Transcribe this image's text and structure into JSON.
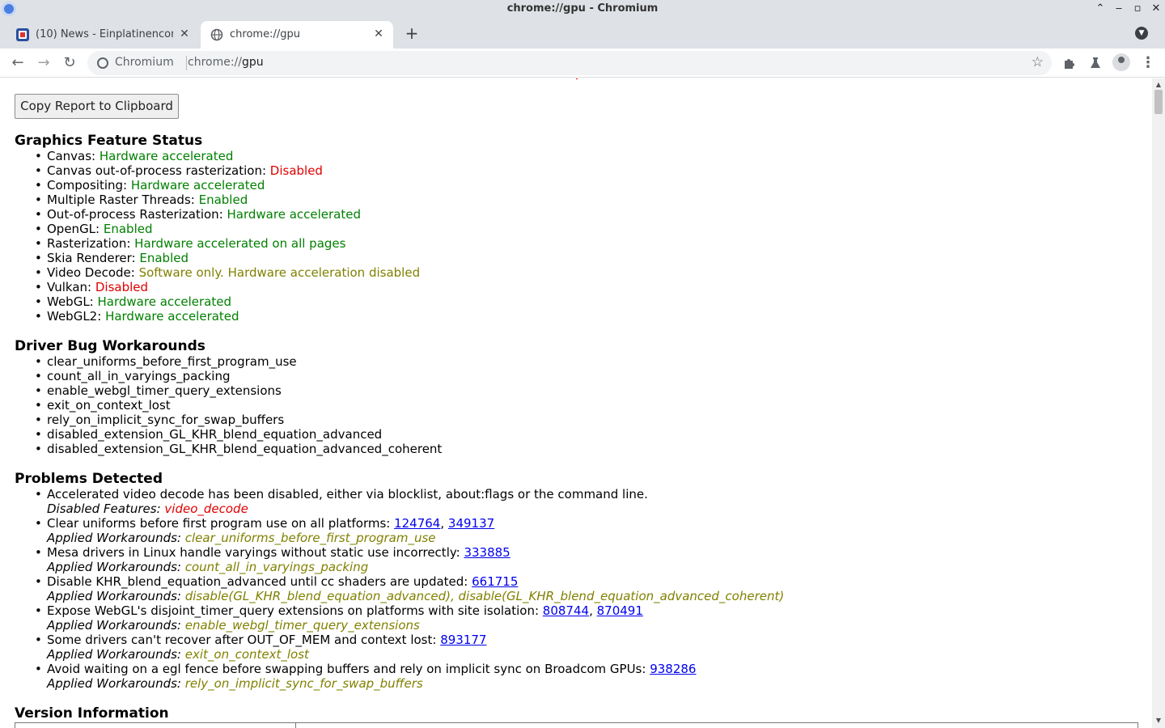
{
  "window": {
    "title": "chrome://gpu - Chromium"
  },
  "tabs": [
    {
      "title": "(10) News - Einplatinencom",
      "active": false
    },
    {
      "title": "chrome://gpu",
      "active": true
    }
  ],
  "toolbar": {
    "omnibox_chip": "Chromium",
    "url_scheme": "chrome://",
    "url_host": "gpu"
  },
  "content": {
    "copy_button": "Copy Report to Clipboard",
    "feature_status": {
      "heading": "Graphics Feature Status",
      "items": [
        {
          "name": "Canvas: ",
          "value": "Hardware accelerated",
          "status": "green"
        },
        {
          "name": "Canvas out-of-process rasterization: ",
          "value": "Disabled",
          "status": "red"
        },
        {
          "name": "Compositing: ",
          "value": "Hardware accelerated",
          "status": "green"
        },
        {
          "name": "Multiple Raster Threads: ",
          "value": "Enabled",
          "status": "green"
        },
        {
          "name": "Out-of-process Rasterization: ",
          "value": "Hardware accelerated",
          "status": "green"
        },
        {
          "name": "OpenGL: ",
          "value": "Enabled",
          "status": "green"
        },
        {
          "name": "Rasterization: ",
          "value": "Hardware accelerated on all pages",
          "status": "green"
        },
        {
          "name": "Skia Renderer: ",
          "value": "Enabled",
          "status": "green"
        },
        {
          "name": "Video Decode: ",
          "value": "Software only. Hardware acceleration disabled",
          "status": "olive"
        },
        {
          "name": "Vulkan: ",
          "value": "Disabled",
          "status": "red"
        },
        {
          "name": "WebGL: ",
          "value": "Hardware accelerated",
          "status": "green"
        },
        {
          "name": "WebGL2: ",
          "value": "Hardware accelerated",
          "status": "green"
        }
      ]
    },
    "workarounds": {
      "heading": "Driver Bug Workarounds",
      "items": [
        "clear_uniforms_before_first_program_use",
        "count_all_in_varyings_packing",
        "enable_webgl_timer_query_extensions",
        "exit_on_context_lost",
        "rely_on_implicit_sync_for_swap_buffers",
        "disabled_extension_GL_KHR_blend_equation_advanced",
        "disabled_extension_GL_KHR_blend_equation_advanced_coherent"
      ]
    },
    "problems": {
      "heading": "Problems Detected",
      "items": [
        {
          "text": "Accelerated video decode has been disabled, either via blocklist, about:flags or the command line.",
          "links": [],
          "sub_label": "Disabled Features: ",
          "sub_values": [
            "video_decode"
          ],
          "sub_status": "red"
        },
        {
          "text": "Clear uniforms before first program use on all platforms: ",
          "links": [
            "124764",
            "349137"
          ],
          "sub_label": "Applied Workarounds: ",
          "sub_values": [
            "clear_uniforms_before_first_program_use"
          ],
          "sub_status": "olive"
        },
        {
          "text": "Mesa drivers in Linux handle varyings without static use incorrectly: ",
          "links": [
            "333885"
          ],
          "sub_label": "Applied Workarounds: ",
          "sub_values": [
            "count_all_in_varyings_packing"
          ],
          "sub_status": "olive"
        },
        {
          "text": "Disable KHR_blend_equation_advanced until cc shaders are updated: ",
          "links": [
            "661715"
          ],
          "sub_label": "Applied Workarounds: ",
          "sub_values": [
            "disable(GL_KHR_blend_equation_advanced)",
            "disable(GL_KHR_blend_equation_advanced_coherent)"
          ],
          "sub_status": "olive"
        },
        {
          "text": "Expose WebGL's disjoint_timer_query extensions on platforms with site isolation: ",
          "links": [
            "808744",
            "870491"
          ],
          "sub_label": "Applied Workarounds: ",
          "sub_values": [
            "enable_webgl_timer_query_extensions"
          ],
          "sub_status": "olive"
        },
        {
          "text": "Some drivers can't recover after OUT_OF_MEM and context lost: ",
          "links": [
            "893177"
          ],
          "sub_label": "Applied Workarounds: ",
          "sub_values": [
            "exit_on_context_lost"
          ],
          "sub_status": "olive"
        },
        {
          "text": "Avoid waiting on a egl fence before swapping buffers and rely on implicit sync on Broadcom GPUs: ",
          "links": [
            "938286"
          ],
          "sub_label": "Applied Workarounds: ",
          "sub_values": [
            "rely_on_implicit_sync_for_swap_buffers"
          ],
          "sub_status": "olive"
        }
      ]
    },
    "version": {
      "heading": "Version Information"
    }
  },
  "colors": {
    "green": "#008000",
    "red": "#e00000",
    "olive": "#808000",
    "link": "#0000ee"
  }
}
